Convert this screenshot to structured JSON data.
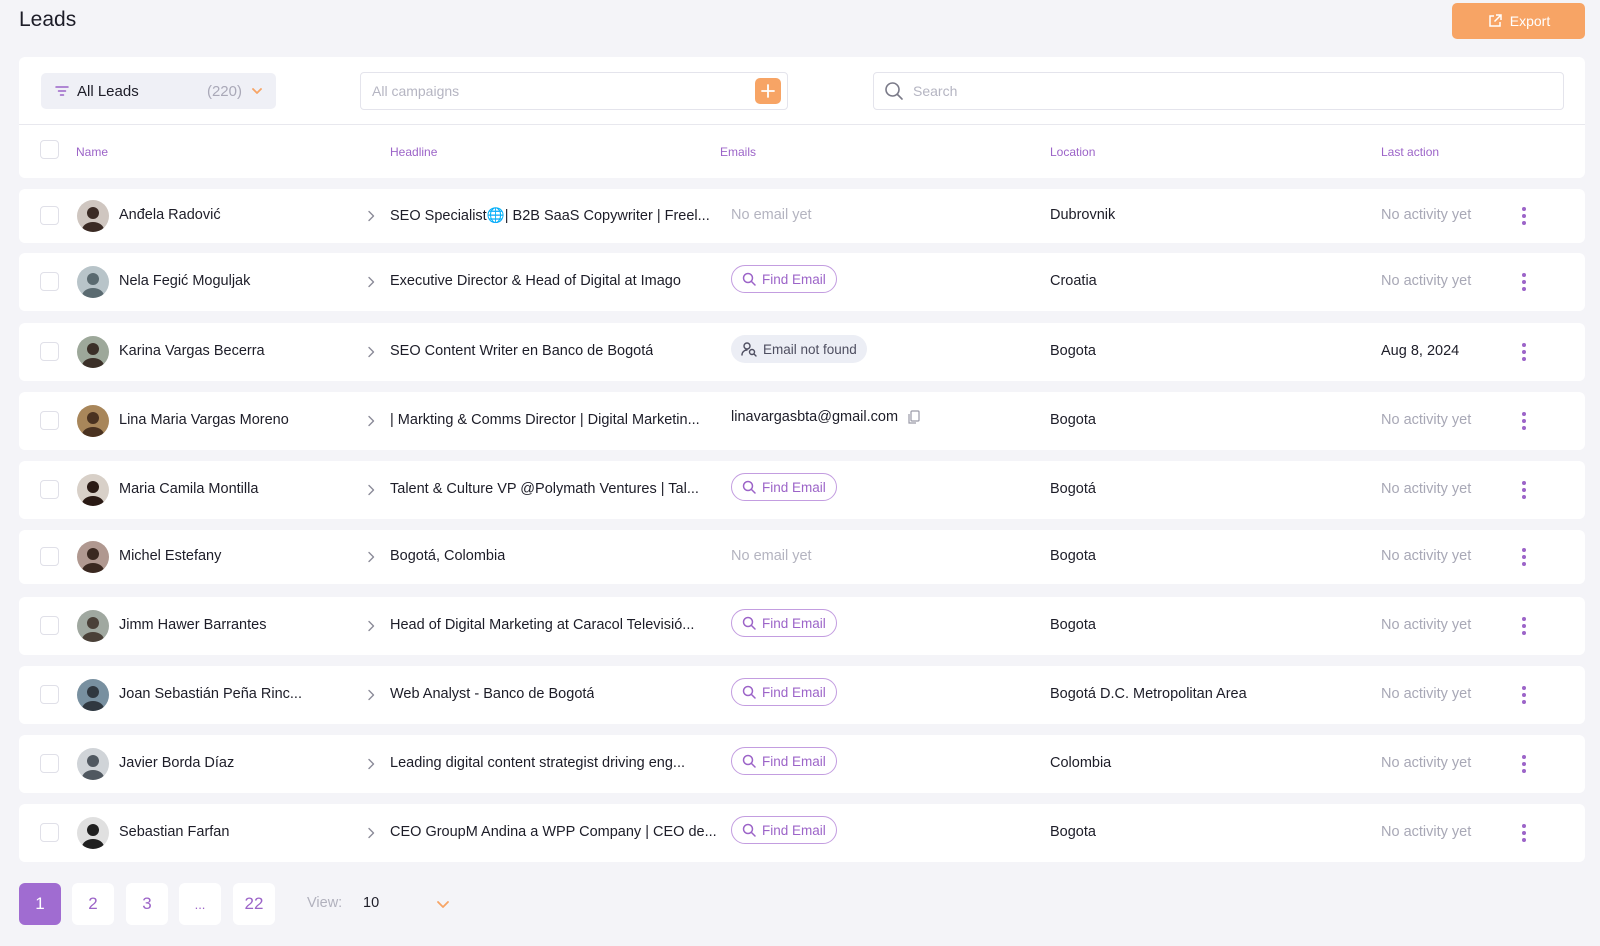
{
  "header": {
    "title": "Leads",
    "export_label": "Export"
  },
  "filters": {
    "all_leads_label": "All Leads",
    "all_leads_count": "(220)",
    "campaigns_placeholder": "All campaigns",
    "search_placeholder": "Search"
  },
  "columns": {
    "name": "Name",
    "headline": "Headline",
    "emails": "Emails",
    "location": "Location",
    "last_action": "Last action"
  },
  "rows": [
    {
      "name": "Anđela Radović",
      "headline": "SEO Specialist🌐| B2B SaaS Copywriter | Freel...",
      "email_type": "muted",
      "email": "No email yet",
      "location": "Dubrovnik",
      "last_action": "No activity yet",
      "last_muted": true
    },
    {
      "name": "Nela Fegić Moguljak",
      "headline": "Executive Director & Head of Digital at Imago",
      "email_type": "find",
      "email": "Find Email",
      "location": "Croatia",
      "last_action": "No activity yet",
      "last_muted": true
    },
    {
      "name": "Karina Vargas Becerra",
      "headline": "SEO Content Writer en Banco de Bogotá",
      "email_type": "notfound",
      "email": "Email not found",
      "location": "Bogota",
      "last_action": "Aug 8, 2024",
      "last_muted": false
    },
    {
      "name": "Lina Maria Vargas Moreno",
      "headline": "| Markting & Comms Director | Digital Marketin...",
      "email_type": "text",
      "email": "linavargasbta@gmail.com",
      "location": "Bogota",
      "last_action": "No activity yet",
      "last_muted": true
    },
    {
      "name": "Maria Camila Montilla",
      "headline": "Talent & Culture VP @Polymath Ventures | Tal...",
      "email_type": "find",
      "email": "Find Email",
      "location": "Bogotá",
      "last_action": "No activity yet",
      "last_muted": true
    },
    {
      "name": "Michel Estefany",
      "headline": "Bogotá, Colombia",
      "email_type": "muted",
      "email": "No email yet",
      "location": "Bogota",
      "last_action": "No activity yet",
      "last_muted": true
    },
    {
      "name": "Jimm Hawer Barrantes",
      "headline": "Head of Digital Marketing at Caracol Televisió...",
      "email_type": "find",
      "email": "Find Email",
      "location": "Bogota",
      "last_action": "No activity yet",
      "last_muted": true
    },
    {
      "name": "Joan Sebastián Peña Rinc...",
      "headline": "Web Analyst - Banco de Bogotá",
      "email_type": "find",
      "email": "Find Email",
      "location": "Bogotá D.C. Metropolitan Area",
      "last_action": "No activity yet",
      "last_muted": true
    },
    {
      "name": "Javier Borda Díaz",
      "headline": "Leading digital content strategist driving eng...",
      "email_type": "find",
      "email": "Find Email",
      "location": "Colombia",
      "last_action": "No activity yet",
      "last_muted": true
    },
    {
      "name": "Sebastian Farfan",
      "headline": "CEO GroupM Andina a WPP Company | CEO de...",
      "email_type": "find",
      "email": "Find Email",
      "location": "Bogota",
      "last_action": "No activity yet",
      "last_muted": true
    }
  ],
  "pagination": {
    "pages": [
      "1",
      "2",
      "3",
      "...",
      "22"
    ],
    "current": "1",
    "view_label": "View:",
    "view_value": "10"
  },
  "colors": {
    "accent_orange": "#f7a465",
    "accent_purple": "#9c64c8",
    "active_page": "#a06cd1",
    "background": "#f4f4f8"
  },
  "icons": {
    "export": "external-link-icon",
    "filter": "filter-lines-icon",
    "search": "magnifier-icon",
    "copy": "copy-icon",
    "more": "kebab-icon"
  }
}
